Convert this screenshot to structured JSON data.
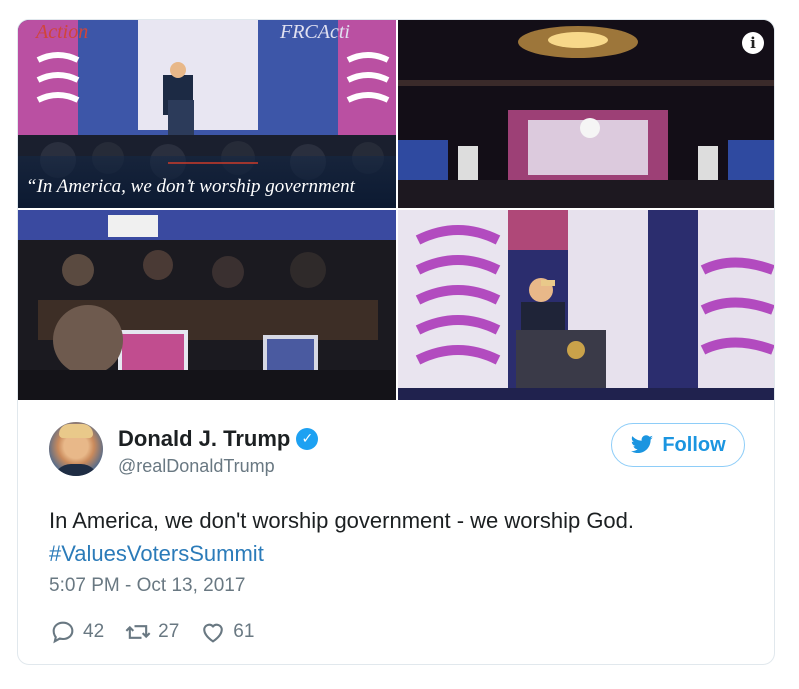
{
  "photos": {
    "caption": "“In America, we don’t worship government",
    "info_icon": "info-icon",
    "stage_banner_text": "FRC Action"
  },
  "tweet": {
    "author_name": "Donald J. Trump",
    "author_handle": "@realDonaldTrump",
    "verified_icon": "verified-badge-icon",
    "follow_label": "Follow",
    "follow_icon": "twitter-bird-icon",
    "text": "In America, we don't worship government - we worship God.",
    "hashtag": "#ValuesVotersSummit",
    "timestamp": "5:07 PM - Oct 13, 2017",
    "replies": "42",
    "retweets": "27",
    "likes": "61"
  },
  "colors": {
    "link_blue": "#2b7bb9",
    "follow_blue": "#1b95e0",
    "verified_blue": "#1da1f2",
    "meta_gray": "#697882"
  }
}
